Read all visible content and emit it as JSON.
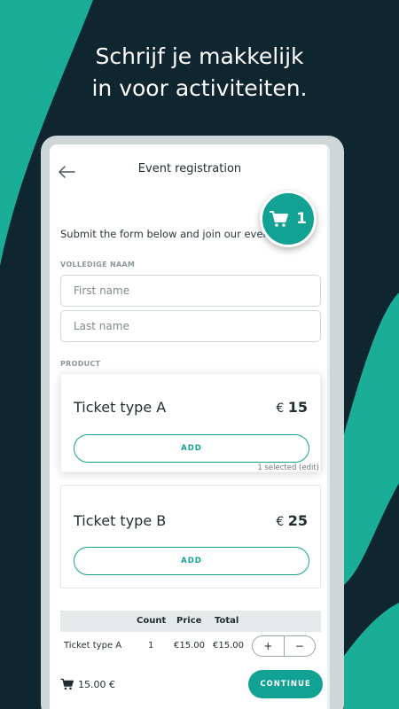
{
  "marketing": {
    "headline_line1": "Schrijf je makkelijk",
    "headline_line2": "in voor activiteiten."
  },
  "colors": {
    "accent": "#12a294",
    "background": "#0f2530",
    "swoosh": "#1aae98"
  },
  "appbar": {
    "back_icon": "arrow-left-icon",
    "title": "Event registration"
  },
  "intro_text": "Submit the form below and join our event!",
  "cart": {
    "icon": "cart-icon",
    "count": "1"
  },
  "name_section": {
    "label": "VOLLEDIGE NAAM",
    "first_name_placeholder": "First name",
    "first_name_value": "",
    "last_name_placeholder": "Last name",
    "last_name_value": ""
  },
  "product_section": {
    "label": "PRODUCT",
    "products": [
      {
        "name": "Ticket type A",
        "currency": "€",
        "price": "15",
        "button_label": "ADD",
        "selected_note": "1 selected (edit)"
      },
      {
        "name": "Ticket type B",
        "currency": "€",
        "price": "25",
        "button_label": "ADD"
      }
    ]
  },
  "summary": {
    "headers": {
      "count": "Count",
      "price": "Price",
      "total": "Total"
    },
    "rows": [
      {
        "item": "Ticket type A",
        "count": "1",
        "price": "€15.00",
        "total": "€15.00",
        "plus_label": "+",
        "minus_label": "−"
      }
    ]
  },
  "footer": {
    "cart_icon": "cart-icon",
    "total": "15.00 €",
    "continue_label": "CONTINUE"
  }
}
